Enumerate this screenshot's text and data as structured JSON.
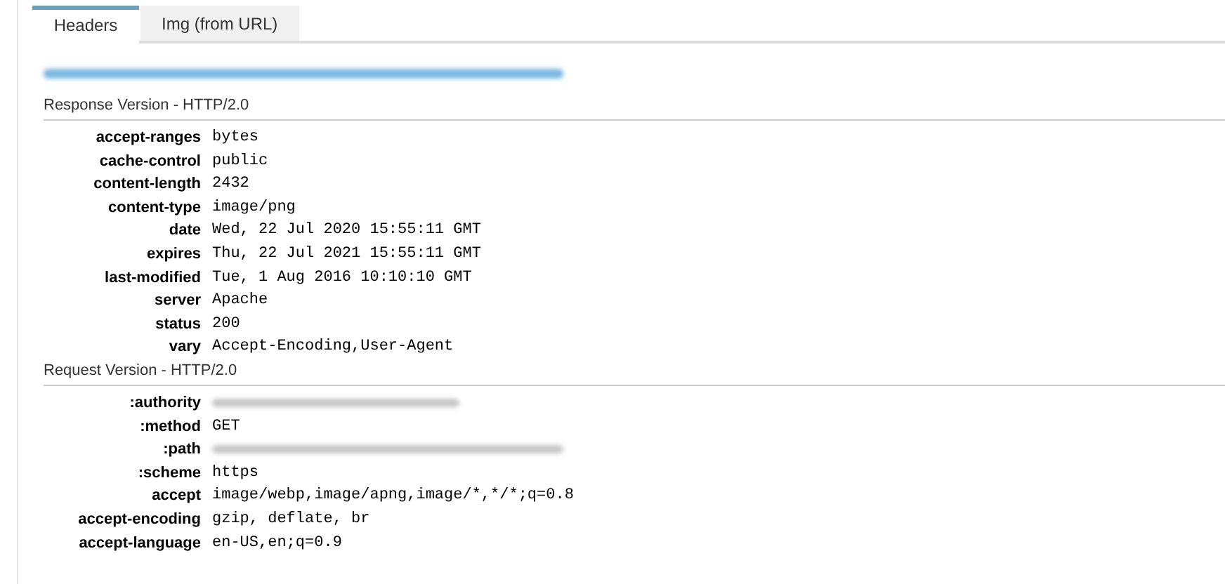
{
  "tabs": [
    {
      "label": "Headers",
      "selected": true
    },
    {
      "label": "Img (from URL)",
      "selected": false
    }
  ],
  "url": {
    "redacted": true
  },
  "sections": [
    {
      "title": "Response Version - HTTP/2.0",
      "headers": [
        {
          "name": "accept-ranges",
          "kind": "text",
          "value": "bytes"
        },
        {
          "name": "cache-control",
          "kind": "text",
          "value": "public"
        },
        {
          "name": "content-length",
          "kind": "text",
          "value": "2432"
        },
        {
          "name": "content-type",
          "kind": "text",
          "value": "image/png"
        },
        {
          "name": "date",
          "kind": "text",
          "value": "Wed, 22 Jul 2020 15:55:11 GMT"
        },
        {
          "name": "expires",
          "kind": "text",
          "value": "Thu, 22 Jul 2021 15:55:11 GMT"
        },
        {
          "name": "last-modified",
          "kind": "text",
          "value": "Tue, 1 Aug 2016 10:10:10 GMT"
        },
        {
          "name": "server",
          "kind": "text",
          "value": "Apache"
        },
        {
          "name": "status",
          "kind": "text",
          "value": "200"
        },
        {
          "name": "vary",
          "kind": "text",
          "value": "Accept-Encoding,User-Agent"
        }
      ]
    },
    {
      "title": "Request Version - HTTP/2.0",
      "headers": [
        {
          "name": ":authority",
          "kind": "redacted"
        },
        {
          "name": ":method",
          "kind": "text",
          "value": "GET"
        },
        {
          "name": ":path",
          "kind": "redacted"
        },
        {
          "name": ":scheme",
          "kind": "text",
          "value": "https"
        },
        {
          "name": "accept",
          "kind": "text",
          "value": "image/webp,image/apng,image/*,*/*;q=0.8"
        },
        {
          "name": "accept-encoding",
          "kind": "text",
          "value": "gzip, deflate, br"
        },
        {
          "name": "accept-language",
          "kind": "text",
          "value": "en-US,en;q=0.9"
        }
      ]
    }
  ]
}
